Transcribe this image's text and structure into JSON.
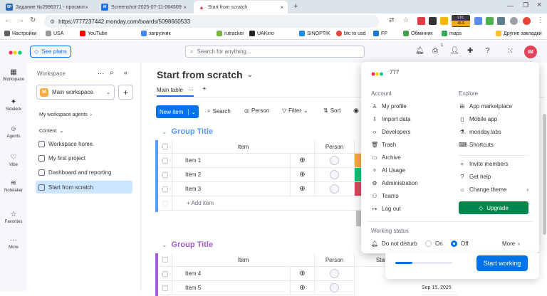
{
  "browser": {
    "tabs": [
      {
        "label": "Задание №2996371 - просмотр з",
        "fav": "SP",
        "color": "#2b6cb0"
      },
      {
        "label": "Screenshot-2025-07-11-064509 hy",
        "fav": "M",
        "color": "#1a73e8"
      },
      {
        "label": "Start from scratch",
        "fav": "",
        "color": "#fff"
      }
    ],
    "url": "https://777237442.monday.com/boards/5098660533",
    "ltc_badge": "LTC",
    "ltc_value": "45.6",
    "bookmarks": [
      "Настройки",
      "USA",
      "YouTube",
      "загрузчик",
      "rutracker",
      "UAKino",
      "SINOPTIK",
      "btc to usd",
      "FP",
      "Обмінник",
      "maps",
      "Другие закладки"
    ]
  },
  "app": {
    "see_plans": "See plans",
    "search_placeholder": "Search for anything...",
    "notif_count": "1",
    "avatar": "IM"
  },
  "rail": [
    "Workspace",
    "Sidekick",
    "Agents",
    "Vibe",
    "Notetaker",
    "Favorites",
    "More"
  ],
  "workspace": {
    "title": "Workspace",
    "selected": "Main workspace",
    "badge": "M",
    "agents": "My workspace agents",
    "content": "Content",
    "items": [
      "Workspace home",
      "My first project",
      "Dashboard and reporting",
      "Start from scratch"
    ]
  },
  "board": {
    "title": "Start from scratch",
    "view_tab": "Main table",
    "new_item": "New item",
    "toolbar": [
      "Search",
      "Person",
      "Filter",
      "Sort"
    ],
    "group1": "Group Title",
    "group2": "Group Title",
    "col_item": "Item",
    "col_person": "Person",
    "col_status": "Stat",
    "items1": [
      "Item 1",
      "Item 2",
      "Item 3"
    ],
    "add_item": "+ Add item",
    "items2": [
      "Item 4",
      "Item 5"
    ],
    "date": "Sep 15, 2025"
  },
  "menu": {
    "account_name": "777",
    "account_title": "Account",
    "explore_title": "Explore",
    "account_items": [
      "My profile",
      "Import data",
      "Developers",
      "Trash",
      "Archive",
      "AI Usage",
      "Administration",
      "Teams",
      "Log out"
    ],
    "explore_items": [
      "App marketplace",
      "Mobile app",
      "monday.labs",
      "Shortcuts"
    ],
    "extra_items": [
      "Invite members",
      "Get help",
      "Change theme"
    ],
    "upgrade": "Upgrade",
    "working_status": "Working status",
    "dnd": "Do not disturb",
    "on": "On",
    "off": "Off",
    "more": "More",
    "start_working": "Start working"
  }
}
